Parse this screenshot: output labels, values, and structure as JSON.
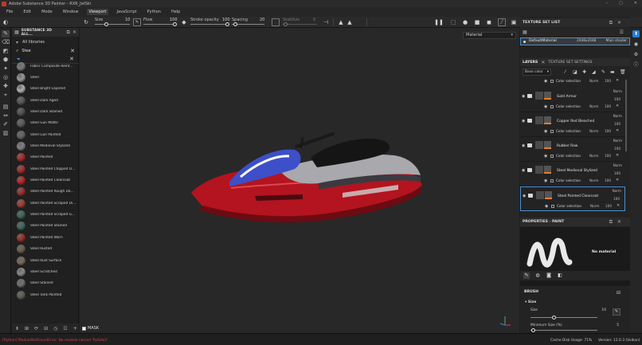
{
  "window": {
    "title": "Adobe Substance 3D Painter - RXR_JetSki"
  },
  "menu": {
    "items": [
      {
        "label": "File"
      },
      {
        "label": "Edit"
      },
      {
        "label": "Mode"
      },
      {
        "label": "Window"
      },
      {
        "label": "Viewport"
      },
      {
        "label": "JavaScript"
      },
      {
        "label": "Python"
      },
      {
        "label": "Help"
      }
    ],
    "active": "Viewport"
  },
  "toolbar": {
    "size_label": "Size",
    "size_value": "10",
    "flow_label": "Flow",
    "flow_value": "100",
    "stroke_opacity_label": "Stroke opacity",
    "stroke_opacity_value": "100",
    "spacing_label": "Spacing",
    "spacing_value": "20",
    "stabilize_label": "Stabilize",
    "stabilize_value": "0"
  },
  "shelf": {
    "title": "SUBSTANCE 3D ALL...",
    "libraries_label": "All libraries",
    "search_query": "Stee",
    "items": [
      {
        "label": "Fabric Composite Reinf...",
        "color": "#7a7a7a"
      },
      {
        "label": "Steel",
        "color": "#9a9a9a"
      },
      {
        "label": "Steel Bright Layered",
        "color": "#b0b0b0"
      },
      {
        "label": "Steel Dark Aged",
        "color": "#555555"
      },
      {
        "label": "Steel Dark Stained",
        "color": "#4e4e4e"
      },
      {
        "label": "Steel Gun Matte",
        "color": "#5c5c5c"
      },
      {
        "label": "Steel Gun Painted",
        "color": "#646464"
      },
      {
        "label": "Steel Medieval Stylized",
        "color": "#808080"
      },
      {
        "label": "Steel Painted",
        "color": "#b12424"
      },
      {
        "label": "Steel Painted Chipped D...",
        "color": "#a72a2a"
      },
      {
        "label": "Steel Painted Clearcoat",
        "color": "#c02020"
      },
      {
        "label": "Steel Painted Rough Da...",
        "color": "#9c2b2b"
      },
      {
        "label": "Steel Painted Scraped Di...",
        "color": "#a33a30"
      },
      {
        "label": "Steel Painted Scraped G...",
        "color": "#3c6656"
      },
      {
        "label": "Steel Painted Stained",
        "color": "#3b6a5a"
      },
      {
        "label": "Steel Painted Worn",
        "color": "#9e2a22"
      },
      {
        "label": "Steel Rusted",
        "color": "#6d5c50"
      },
      {
        "label": "Steel Rust Surface",
        "color": "#7a6a5e"
      },
      {
        "label": "Steel Scratched",
        "color": "#8a8a8a"
      },
      {
        "label": "Steel Stained",
        "color": "#707070"
      },
      {
        "label": "Steel Tank Painted",
        "color": "#5d5d55"
      }
    ]
  },
  "viewport": {
    "material_mode": "Material",
    "mask_label": "MASK"
  },
  "texture_set_list": {
    "title": "TEXTURE SET LIST",
    "row": {
      "name": "DefaultMaterial",
      "resolution": "2048x2048",
      "shader": "Main shader"
    }
  },
  "layers": {
    "tab_layers": "LAYERS",
    "tab_settings": "TEXTURE SET SETTINGS",
    "channel": "Base color",
    "top_sub": {
      "label": "Color selection",
      "mode": "Norm",
      "value": "100"
    },
    "items": [
      {
        "name": "Gold Armor",
        "blend": "Norm",
        "opacity": "100",
        "sub": "Color selection",
        "sub_mode": "Norm",
        "sub_value": "100"
      },
      {
        "name": "Copper Red Bleached",
        "blend": "Norm",
        "opacity": "100",
        "sub": "Color selection",
        "sub_mode": "Norm",
        "sub_value": "100"
      },
      {
        "name": "Rubber Raw",
        "blend": "Norm",
        "opacity": "100",
        "sub": "Color selection",
        "sub_mode": "Norm",
        "sub_value": "100"
      },
      {
        "name": "Steel Medieval Stylized",
        "blend": "Norm",
        "opacity": "100",
        "sub": "Color selection",
        "sub_mode": "Norm",
        "sub_value": "100"
      },
      {
        "name": "Steel Painted Clearcoat",
        "blend": "Norm",
        "opacity": "100",
        "sub": "Color selection",
        "sub_mode": "Norm",
        "sub_value": "100"
      }
    ]
  },
  "properties": {
    "title": "PROPERTIES - PAINT",
    "no_material": "No material",
    "brush_title": "BRUSH",
    "size_group": "Size",
    "size_label": "Size",
    "size_value": "10",
    "min_size_label": "Minimum Size (%)",
    "min_size_value": "5"
  },
  "status": {
    "error": "[Python] ModuleNotFoundError: No module named 'PySide2'",
    "cache": "Cache Disk Usage:  71%",
    "version": "Version: 12.0.3 (Vulkan)"
  }
}
